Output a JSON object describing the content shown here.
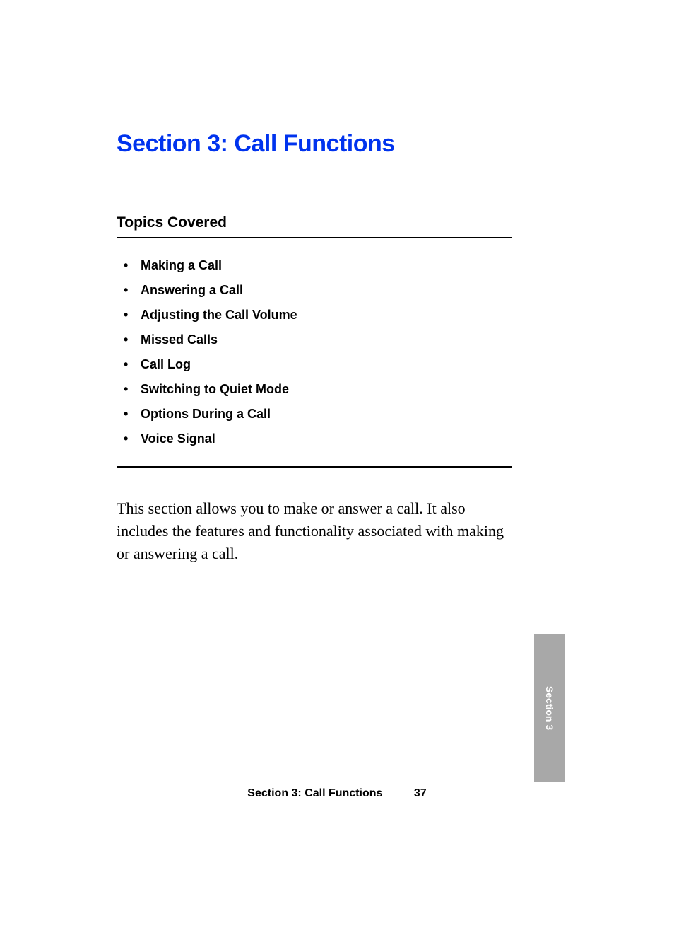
{
  "title": "Section 3: Call Functions",
  "topics_heading": "Topics Covered",
  "topics": [
    "Making a Call",
    "Answering a Call",
    "Adjusting the Call Volume",
    "Missed Calls",
    "Call Log",
    "Switching to Quiet Mode",
    "Options During a Call",
    "Voice Signal"
  ],
  "body": "This section allows you to make or answer a call. It also includes the features and functionality associated with making or answering a call.",
  "thumb_tab": "Section 3",
  "footer": {
    "title": "Section 3: Call Functions",
    "page": "37"
  }
}
